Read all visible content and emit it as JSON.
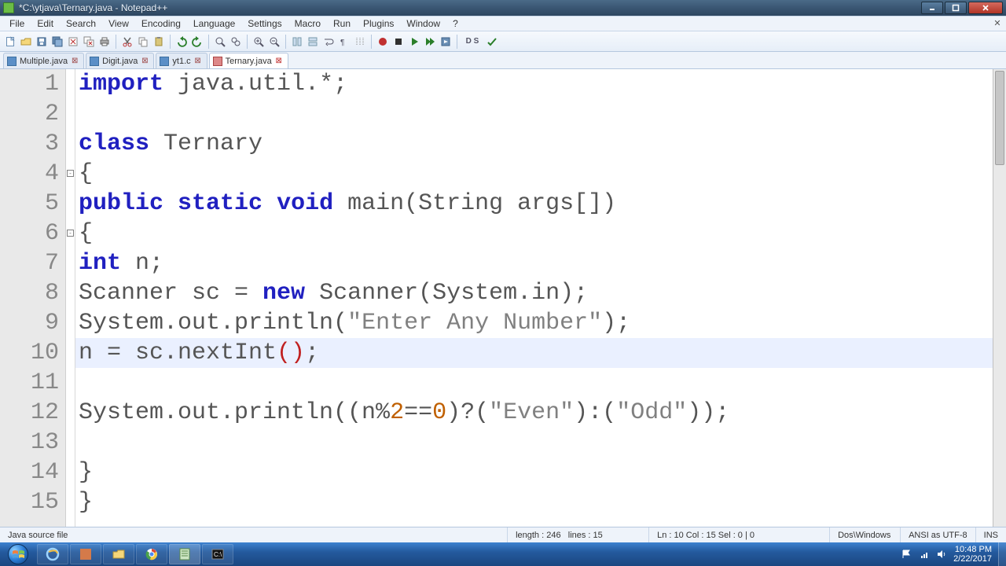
{
  "window": {
    "title": "*C:\\ytjava\\Ternary.java - Notepad++"
  },
  "menubar": {
    "items": [
      "File",
      "Edit",
      "Search",
      "View",
      "Encoding",
      "Language",
      "Settings",
      "Macro",
      "Run",
      "Plugins",
      "Window",
      "?"
    ]
  },
  "tabs": {
    "items": [
      {
        "label": "Multiple.java",
        "active": false
      },
      {
        "label": "Digit.java",
        "active": false
      },
      {
        "label": "yt1.c",
        "active": false
      },
      {
        "label": "Ternary.java",
        "active": true
      }
    ]
  },
  "editor": {
    "highlight_line": 10,
    "caret": {
      "line": 10,
      "col": 15
    },
    "line_count": 15,
    "lines": {
      "l1": [
        [
          "kw",
          "import"
        ],
        [
          "",
          " java.util.*;"
        ]
      ],
      "l2": [
        [
          "",
          ""
        ]
      ],
      "l3": [
        [
          "kw",
          "class"
        ],
        [
          "",
          " Ternary"
        ]
      ],
      "l4": [
        [
          "",
          "{"
        ]
      ],
      "l5": [
        [
          "kw",
          "public"
        ],
        [
          "",
          " "
        ],
        [
          "kw",
          "static"
        ],
        [
          "",
          " "
        ],
        [
          "kw",
          "void"
        ],
        [
          "",
          " main(String args[])"
        ]
      ],
      "l6": [
        [
          "",
          "{"
        ]
      ],
      "l7": [
        [
          "kw",
          "int"
        ],
        [
          "",
          " n;"
        ]
      ],
      "l8": [
        [
          "",
          "Scanner sc = "
        ],
        [
          "kw",
          "new"
        ],
        [
          "",
          " Scanner(System.in);"
        ]
      ],
      "l9": [
        [
          "",
          "System.out.println("
        ],
        [
          "str",
          "\"Enter Any Number\""
        ],
        [
          "",
          ");"
        ]
      ],
      "l10": [
        [
          "",
          "n = sc.nextInt"
        ],
        [
          "paren",
          "()"
        ],
        [
          "",
          ";"
        ]
      ],
      "l11": [
        [
          "",
          ""
        ]
      ],
      "l12": [
        [
          "",
          "System.out.println((n%"
        ],
        [
          "num",
          "2"
        ],
        [
          "",
          "=="
        ],
        [
          "num",
          "0"
        ],
        [
          "",
          ")?("
        ],
        [
          "str",
          "\"Even\""
        ],
        [
          "",
          "):("
        ],
        [
          "str",
          "\"Odd\""
        ],
        [
          "",
          "));"
        ]
      ],
      "l13": [
        [
          "",
          ""
        ]
      ],
      "l14": [
        [
          "",
          "}"
        ]
      ],
      "l15": [
        [
          "",
          "}"
        ]
      ]
    },
    "fold_markers": [
      4,
      6
    ]
  },
  "statusbar": {
    "language": "Java source file",
    "length_label": "length : 246",
    "lines_label": "lines : 15",
    "pos_label": "Ln : 10    Col : 15    Sel : 0 | 0",
    "eol": "Dos\\Windows",
    "encoding": "ANSI as UTF-8",
    "mode": "INS"
  },
  "taskbar": {
    "clock_time": "10:48 PM",
    "clock_date": "2/22/2017"
  }
}
